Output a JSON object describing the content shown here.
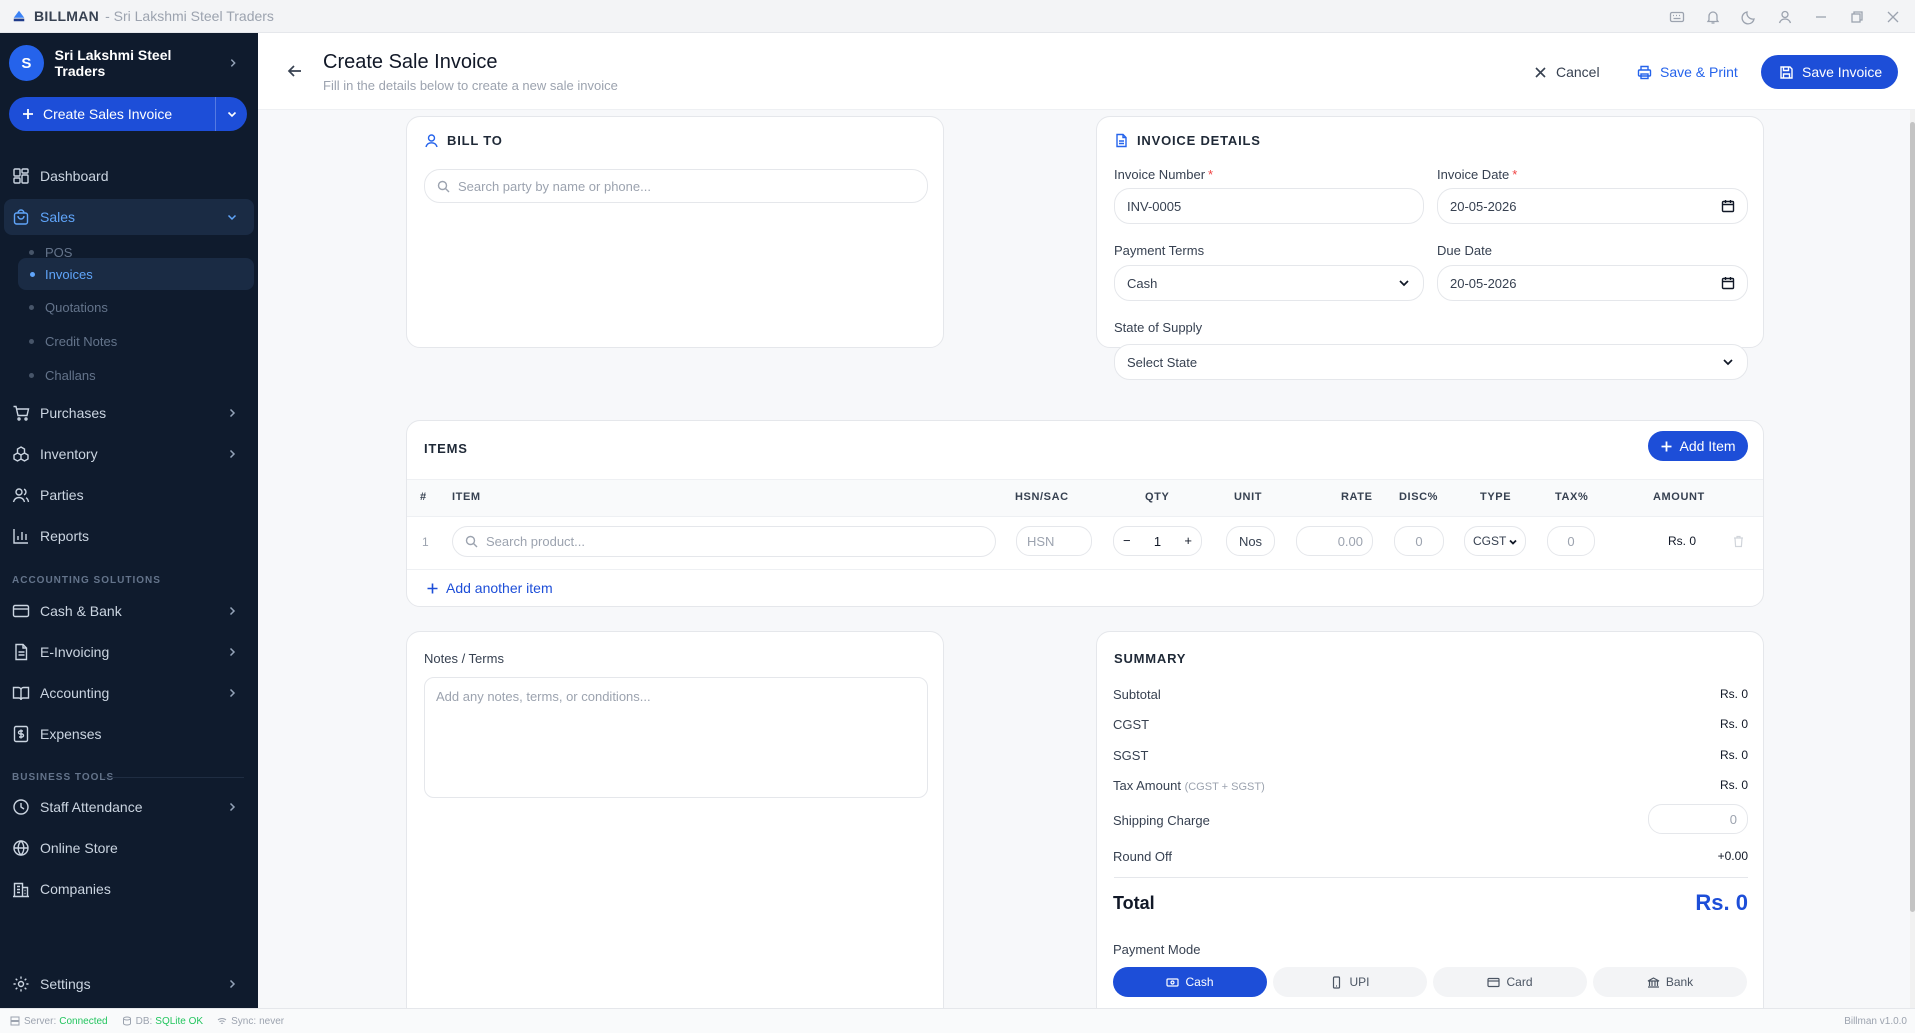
{
  "titlebar": {
    "app_name": "BILLMAN",
    "subtitle": "- Sri Lakshmi Steel Traders"
  },
  "sidebar": {
    "company_initial": "S",
    "company_name": "Sri Lakshmi Steel Traders",
    "create_label": "Create Sales Invoice",
    "items": {
      "dashboard": "Dashboard",
      "sales": "Sales",
      "purchases": "Purchases",
      "inventory": "Inventory",
      "parties": "Parties",
      "reports": "Reports",
      "cash_bank": "Cash & Bank",
      "einvoicing": "E-Invoicing",
      "accounting": "Accounting",
      "expenses": "Expenses",
      "staff_attendance": "Staff Attendance",
      "online_store": "Online Store",
      "companies": "Companies",
      "settings": "Settings"
    },
    "sales_sub": [
      "POS",
      "Invoices",
      "Quotations",
      "Credit Notes",
      "Challans"
    ],
    "section_accounting": "ACCOUNTING SOLUTIONS",
    "section_business": "BUSINESS TOOLS"
  },
  "header": {
    "title": "Create Sale Invoice",
    "subtitle": "Fill in the details below to create a new sale invoice",
    "cancel": "Cancel",
    "save_print": "Save & Print",
    "save": "Save Invoice"
  },
  "bill_to": {
    "title": "BILL TO",
    "search_placeholder": "Search party by name or phone..."
  },
  "invoice_details": {
    "title": "INVOICE DETAILS",
    "number_label": "Invoice Number",
    "number_value": "INV-0005",
    "date_label": "Invoice Date",
    "date_value": "20-05-2026",
    "terms_label": "Payment Terms",
    "terms_value": "Cash",
    "due_label": "Due Date",
    "due_value": "20-05-2026",
    "state_label": "State of Supply",
    "state_value": "Select State"
  },
  "items": {
    "title": "ITEMS",
    "add_item": "Add Item",
    "columns": [
      "#",
      "ITEM",
      "HSN/SAC",
      "QTY",
      "UNIT",
      "RATE",
      "DISC%",
      "TYPE",
      "TAX%",
      "AMOUNT"
    ],
    "row": {
      "index": "1",
      "product_placeholder": "Search product...",
      "hsn_placeholder": "HSN",
      "minus": "−",
      "qty": "1",
      "plus": "+",
      "unit": "Nos",
      "rate_placeholder": "0.00",
      "disc_placeholder": "0",
      "type": "CGST",
      "tax_placeholder": "0",
      "amount": "Rs. 0"
    },
    "add_another": "Add another item"
  },
  "notes": {
    "label": "Notes / Terms",
    "placeholder": "Add any notes, terms, or conditions..."
  },
  "summary": {
    "title": "SUMMARY",
    "subtotal_label": "Subtotal",
    "subtotal": "Rs. 0",
    "cgst_label": "CGST",
    "cgst": "Rs. 0",
    "sgst_label": "SGST",
    "sgst": "Rs. 0",
    "tax_label": "Tax Amount",
    "tax_note": "(CGST + SGST)",
    "tax": "Rs. 0",
    "shipping_label": "Shipping Charge",
    "shipping_placeholder": "0",
    "roundoff_label": "Round Off",
    "roundoff": "+0.00",
    "total_label": "Total",
    "total": "Rs. 0",
    "payment_mode_label": "Payment Mode",
    "payment_modes": [
      "Cash",
      "UPI",
      "Card",
      "Bank"
    ]
  },
  "statusbar": {
    "server_label": "Server:",
    "server_value": "Connected",
    "db_label": "DB:",
    "db_value": "SQLite OK",
    "sync_label": "Sync:",
    "sync_value": "never",
    "version": "Billman v1.0.0"
  },
  "colors": {
    "primary": "#1d4ed8",
    "sidebar_bg": "#0f1b2d",
    "accent": "#60a5fa",
    "status_ok": "#22c55e",
    "required": "#ef4444"
  }
}
